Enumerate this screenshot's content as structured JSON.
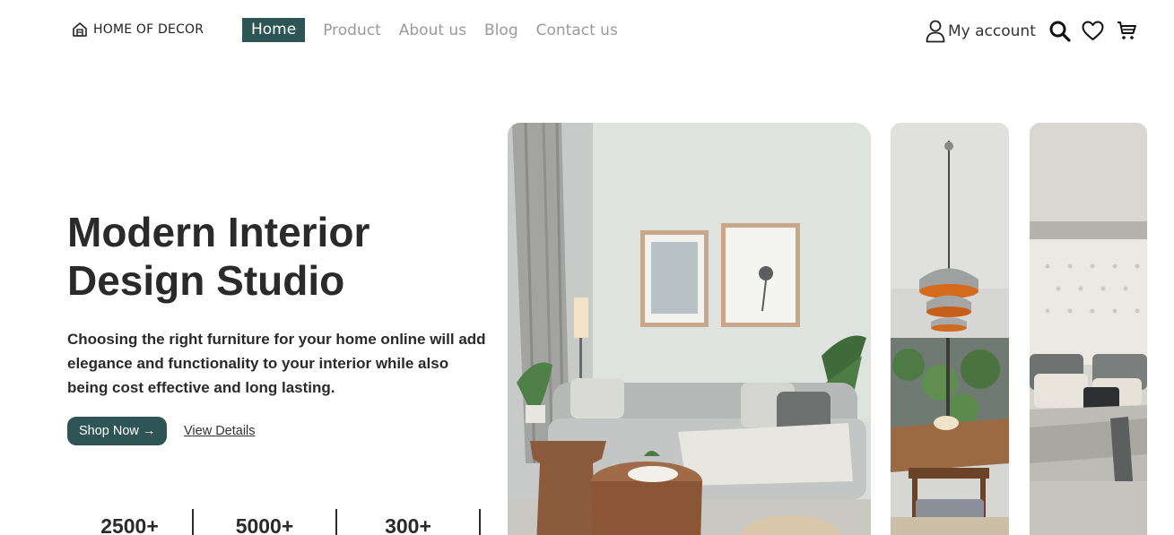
{
  "header": {
    "logo_text": "HOME OF DECOR",
    "nav": [
      {
        "label": "Home",
        "active": true
      },
      {
        "label": "Product",
        "active": false
      },
      {
        "label": "About us",
        "active": false
      },
      {
        "label": "Blog",
        "active": false
      },
      {
        "label": "Contact us",
        "active": false
      }
    ],
    "account_label": "My account",
    "icons": [
      "user-icon",
      "search-icon",
      "heart-icon",
      "cart-icon"
    ]
  },
  "hero": {
    "title_line1": "Modern Interior",
    "title_line2": "Design Studio",
    "description": "Choosing the right furniture for your home online will add elegance and functionality to your interior while also being cost effective and long lasting.",
    "primary_button": "Shop Now →",
    "secondary_link": "View Details"
  },
  "stats": [
    "2500+",
    "5000+",
    "300+"
  ],
  "colors": {
    "accent": "#2d5555",
    "text": "#2a2a2a",
    "nav_inactive": "#9a9a9a"
  }
}
